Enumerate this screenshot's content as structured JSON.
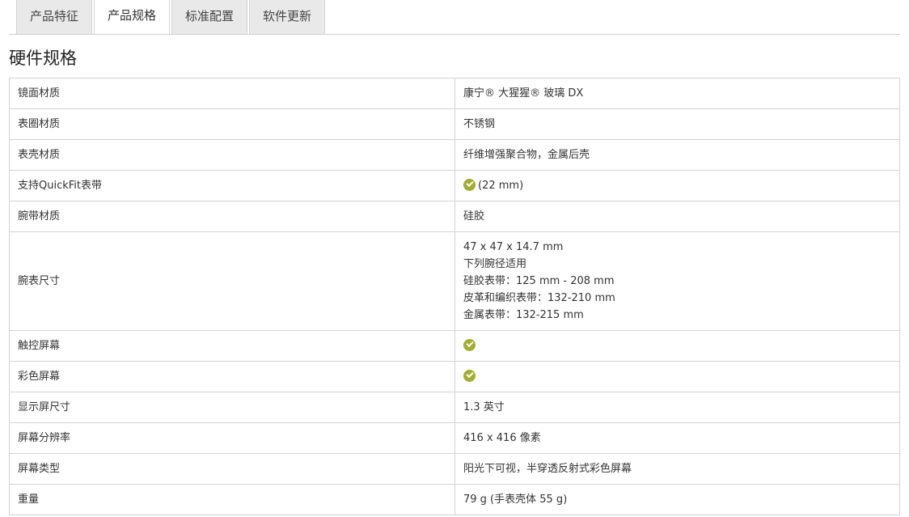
{
  "tabs": [
    {
      "label": "产品特征",
      "active": false
    },
    {
      "label": "产品规格",
      "active": true
    },
    {
      "label": "标准配置",
      "active": false
    },
    {
      "label": "软件更新",
      "active": false
    }
  ],
  "section": {
    "title": "硬件规格"
  },
  "specs": [
    {
      "key": "镜面材质",
      "value": "康宁® 大猩猩® 玻璃 DX"
    },
    {
      "key": "表圈材质",
      "value": "不锈钢"
    },
    {
      "key": "表壳材质",
      "value": "纤维增强聚合物，金属后壳"
    },
    {
      "key": "支持QuickFit表带",
      "check": true,
      "value": "(22 mm)"
    },
    {
      "key": "腕带材质",
      "value": "硅胶"
    },
    {
      "key": "腕表尺寸",
      "lines": [
        "47 x 47 x 14.7 mm",
        "下列腕径适用",
        "硅胶表带：125 mm - 208 mm",
        "皮革和编织表带：132-210 mm",
        "金属表带：132-215 mm"
      ]
    },
    {
      "key": "触控屏幕",
      "check": true
    },
    {
      "key": "彩色屏幕",
      "check": true
    },
    {
      "key": "显示屏尺寸",
      "value": "1.3 英寸"
    },
    {
      "key": "屏幕分辨率",
      "value": "416 x 416 像素"
    },
    {
      "key": "屏幕类型",
      "value": "阳光下可视，半穿透反射式彩色屏幕"
    },
    {
      "key": "重量",
      "value": "79 g (手表壳体 55 g)"
    }
  ],
  "colors": {
    "check": "#a2ad32",
    "border": "#d4d4d4",
    "tab_bg": "#e9e9e9"
  },
  "icons": {
    "check": "check-circle-icon"
  }
}
